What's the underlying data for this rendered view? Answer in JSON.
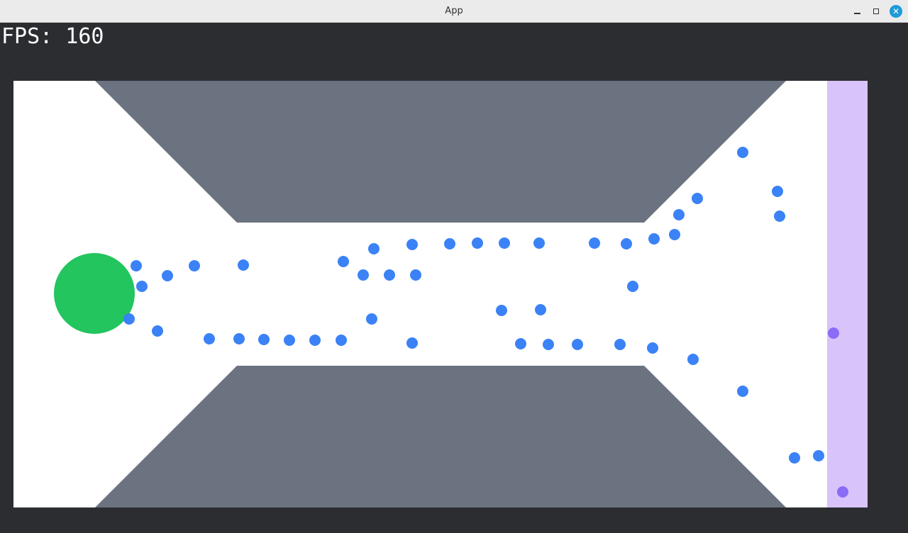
{
  "window": {
    "title": "App",
    "controls": {
      "minimize": "–",
      "maximize": "",
      "close": "✕"
    }
  },
  "hud": {
    "fps_text": "FPS: 160"
  },
  "colors": {
    "background": "#2b2d31",
    "arena": "#ffffff",
    "wall": "#6b7280",
    "goal_zone": "#d8c4fa",
    "agent": "#22c55e",
    "particle": "#3b82f6",
    "goal_particle": "#8b6cf6"
  },
  "icons": {
    "minimize": "minimize-icon",
    "maximize": "maximize-icon",
    "close": "close-icon"
  },
  "scene_objects": {
    "particle_count": 53,
    "goal_particle_count": 2
  }
}
